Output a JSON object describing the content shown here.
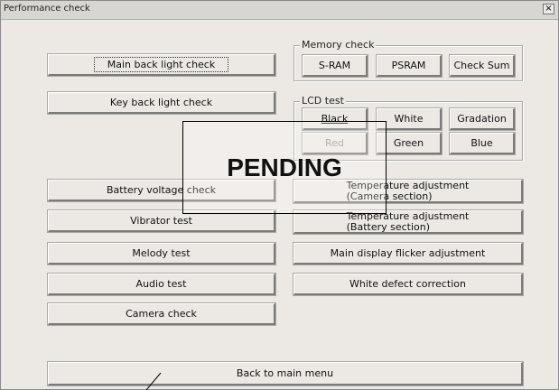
{
  "window": {
    "title": "Performance check",
    "close_label": "×"
  },
  "left_buttons": {
    "main_back_light": "Main back light check",
    "key_back_light": "Key back light check",
    "battery_voltage": "Battery voltage check",
    "vibrator": "Vibrator test",
    "melody": "Melody test",
    "audio": "Audio test",
    "camera": "Camera check"
  },
  "memory_check": {
    "legend": "Memory check",
    "sram": "S-RAM",
    "psram": "PSRAM",
    "check_sum": "Check Sum"
  },
  "lcd_test": {
    "legend": "LCD test",
    "black": "Black",
    "white": "White",
    "gradation": "Gradation",
    "red": "Red",
    "green": "Green",
    "blue": "Blue"
  },
  "right_buttons": {
    "temp_camera_line1": "Temperature adjustment",
    "temp_camera_line2": "(Camera section)",
    "temp_battery_line1": "Temperature adjustment",
    "temp_battery_line2": "(Battery section)",
    "main_display_flicker": "Main display flicker adjustment",
    "white_defect": "White defect correction"
  },
  "back_to_main": "Back to main menu",
  "overlay": {
    "text": "PENDING"
  }
}
